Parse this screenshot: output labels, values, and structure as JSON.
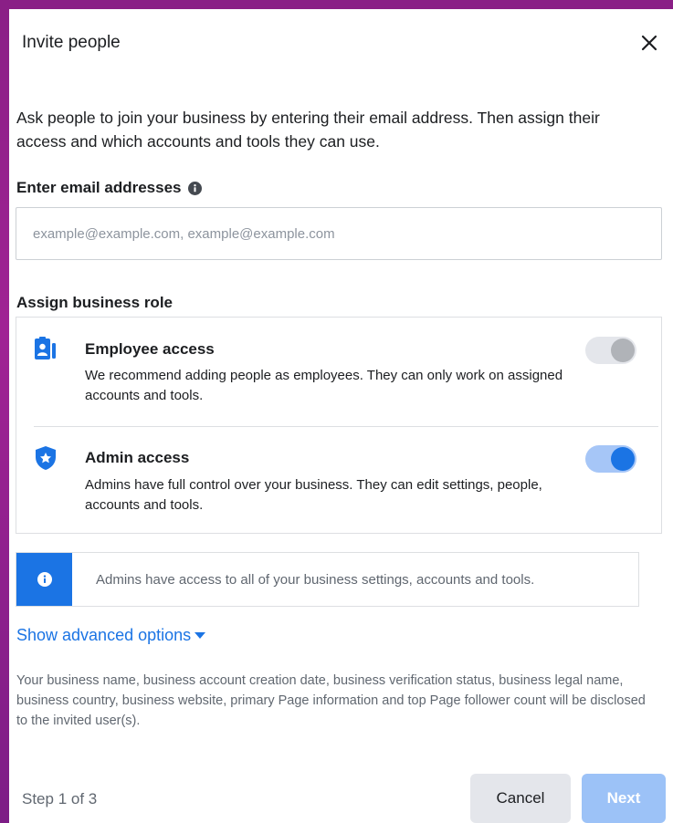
{
  "dialog": {
    "title": "Invite people",
    "description": "Ask people to join your business by entering their email address. Then assign their access and which accounts and tools they can use."
  },
  "email": {
    "label": "Enter email addresses",
    "placeholder": "example@example.com, example@example.com",
    "value": ""
  },
  "role": {
    "label": "Assign business role",
    "options": [
      {
        "title": "Employee access",
        "description": "We recommend adding people as employees. They can only work on assigned accounts and tools.",
        "enabled": false,
        "icon": "employee-badge-icon"
      },
      {
        "title": "Admin access",
        "description": "Admins have full control over your business. They can edit settings, people, accounts and tools.",
        "enabled": true,
        "icon": "shield-star-icon"
      }
    ]
  },
  "banner": {
    "text": "Admins have access to all of your business settings, accounts and tools."
  },
  "advanced": {
    "label": "Show advanced options"
  },
  "disclosure": {
    "text": "Your business name, business account creation date, business verification status, business legal name, business country, business website, primary Page information and top Page follower count will be disclosed to the invited user(s)."
  },
  "footer": {
    "step": "Step 1 of 3",
    "cancel_label": "Cancel",
    "next_label": "Next"
  },
  "colors": {
    "accent": "#1b74e4",
    "next_disabled": "#9cc2f7",
    "backdrop": "#a02394"
  }
}
